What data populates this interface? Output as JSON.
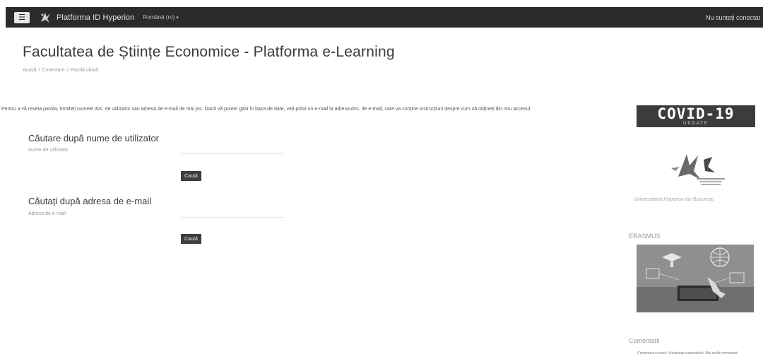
{
  "navbar": {
    "menu_icon": "☰",
    "brand": "Platforma ID Hyperion",
    "language": "Română (ro)",
    "login_status": "Nu sunteți conectat"
  },
  "page": {
    "title": "Facultatea de Științe Economice - Platforma e-Learning",
    "breadcrumb": [
      "Acasă",
      "Conectare",
      "Parolă uitată"
    ],
    "breadcrumb_separator": "/"
  },
  "instructions": "Pentru a vă reseta parola, trimiteți numele dvs. de utilizator sau adresa de e-mail de mai jos. Dacă vă putem găsi în baza de date, veți primi un e-mail la adresa dvs. de e-mail, care va conține instrucțiuni despre cum să obțineți din nou accesul.",
  "username_search": {
    "title": "Căutare după nume de utilizator",
    "label": "Nume de utilizator",
    "value": "",
    "button": "Caută"
  },
  "email_search": {
    "title": "Căutați după adresa de e-mail",
    "label": "Adresa de e-mail",
    "value": "",
    "button": "Caută"
  },
  "sidebar": {
    "covid_title": "COVID-19",
    "covid_sub": "UPDATE",
    "university_link": "Universitatea Hyperion din București",
    "erasmus_title": "ERASMUS",
    "comments_title": "Comentarii",
    "comments_text": "Comentariu recent. Vizualizați comentariul. Mai multe comentarii"
  },
  "icons": {
    "menu": "hamburger-menu-icon",
    "logo": "hyperion-logo-icon",
    "language": "chevron-down-icon"
  },
  "colors": {
    "navbar_bg": "#2b2b2b",
    "button_bg": "#3e3e3e",
    "title": "#3a3a3a"
  }
}
